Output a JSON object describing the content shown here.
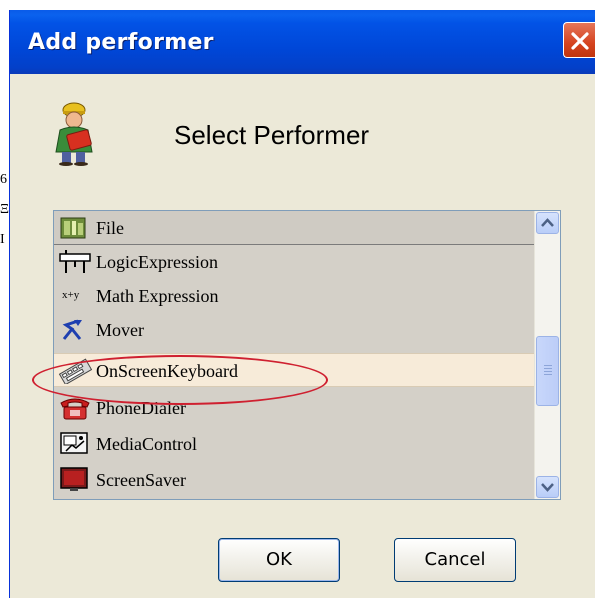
{
  "dialog": {
    "title": "Add performer",
    "heading": "Select Performer"
  },
  "list": {
    "items": [
      {
        "label": "File",
        "icon": "file-icon"
      },
      {
        "label": "LogicExpression",
        "icon": "logic-expression-icon"
      },
      {
        "label": "Math Expression",
        "icon": "math-expression-icon"
      },
      {
        "label": "Mover",
        "icon": "mover-icon"
      },
      {
        "label": "OnScreenKeyboard",
        "icon": "keyboard-icon"
      },
      {
        "label": "PhoneDialer",
        "icon": "phone-icon"
      },
      {
        "label": "MediaControl",
        "icon": "media-control-icon"
      },
      {
        "label": "ScreenSaver",
        "icon": "screen-saver-icon"
      }
    ],
    "selected": "OnScreenKeyboard"
  },
  "buttons": {
    "ok": "OK",
    "cancel": "Cancel"
  },
  "math_icon_text": "x+y",
  "background_fragments": [
    "6",
    "Ξ",
    "I"
  ],
  "colors": {
    "titlebar": "#0047d8",
    "highlight_ring": "#cf2030",
    "selected_row": "#f7ebd9"
  }
}
